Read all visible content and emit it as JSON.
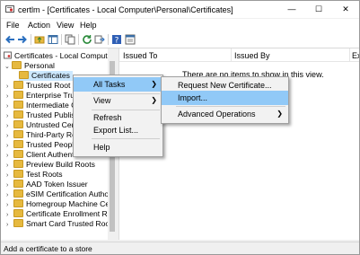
{
  "window": {
    "title": "certlm - [Certificates - Local Computer\\Personal\\Certificates]",
    "minimize": "—",
    "maximize": "☐",
    "close": "✕"
  },
  "menubar": [
    "File",
    "Action",
    "View",
    "Help"
  ],
  "toolbar": {
    "icons": [
      "back-arrow-icon",
      "forward-arrow-icon",
      "up-folder-icon",
      "show-hide-tree-icon",
      "copy-icon",
      "refresh-icon",
      "export-icon",
      "help-icon",
      "properties-icon"
    ]
  },
  "tree": {
    "root": "Certificates - Local Computer",
    "items": [
      "Personal",
      "Certificates",
      "Trusted Root Ce",
      "Enterprise Trust",
      "Intermediate Ce",
      "Trusted Publish",
      "Untrusted Certi",
      "Third-Party Roo",
      "Trusted People",
      "Client Authentication Issu",
      "Preview Build Roots",
      "Test Roots",
      "AAD Token Issuer",
      "eSIM Certification Authori",
      "Homegroup Machine Cer",
      "Certificate Enrollment Rec",
      "Smart Card Trusted Roots"
    ]
  },
  "list": {
    "columns": [
      "Issued To",
      "Issued By",
      "Ex"
    ],
    "empty_text": "There are no items to show in this view."
  },
  "context_menu": {
    "items": [
      "All Tasks",
      "View",
      "Refresh",
      "Export List...",
      "Help"
    ]
  },
  "submenu": {
    "items": [
      "Request New Certificate...",
      "Import...",
      "Advanced Operations"
    ]
  },
  "status": "Add a certificate to a store"
}
